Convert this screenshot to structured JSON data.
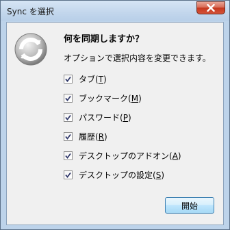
{
  "window": {
    "title": "Sync を選択",
    "close_icon": "close-icon"
  },
  "dialog": {
    "icon": "sync-icon",
    "heading": "何を同期しますか？",
    "description": "オプションで選択内容を変更できます。",
    "options": [
      {
        "label": "タブ",
        "mnemonic": "T",
        "checked": true
      },
      {
        "label": "ブックマーク",
        "mnemonic": "M",
        "checked": true
      },
      {
        "label": "パスワード",
        "mnemonic": "P",
        "checked": true
      },
      {
        "label": "履歴",
        "mnemonic": "R",
        "checked": true
      },
      {
        "label": "デスクトップのアドオン",
        "mnemonic": "A",
        "checked": true
      },
      {
        "label": "デスクトップの設定",
        "mnemonic": "S",
        "checked": true
      }
    ],
    "start_button": "開始"
  }
}
